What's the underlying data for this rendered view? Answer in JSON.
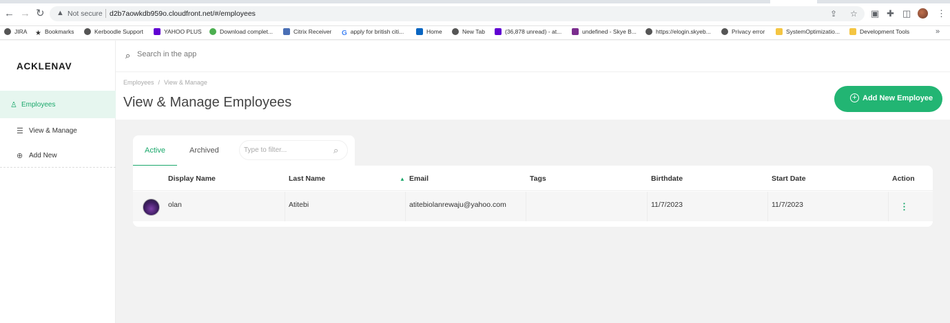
{
  "browser": {
    "security_label": "Not secure",
    "url": "d2b7aowkdb959o.cloudfront.net/#/employees",
    "bookmarks": [
      {
        "label": "JIRA"
      },
      {
        "label": "Bookmarks"
      },
      {
        "label": "Kerboodle Support"
      },
      {
        "label": "YAHOO PLUS"
      },
      {
        "label": "Download complet..."
      },
      {
        "label": "Citrix Receiver"
      },
      {
        "label": "apply for british citi..."
      },
      {
        "label": "Home"
      },
      {
        "label": "New Tab"
      },
      {
        "label": "(36,878 unread) - at..."
      },
      {
        "label": "undefined - Skye B..."
      },
      {
        "label": "https://elogin.skyeb..."
      },
      {
        "label": "Privacy error"
      },
      {
        "label": "SystemOptimizatio..."
      },
      {
        "label": "Development Tools"
      }
    ],
    "overflow": "»"
  },
  "app": {
    "logo": "ACKLENAV",
    "search_placeholder": "Search in the app",
    "sidebar": {
      "section": "Employees",
      "items": [
        {
          "label": "View & Manage"
        },
        {
          "label": "Add New"
        }
      ]
    },
    "breadcrumb": {
      "root": "Employees",
      "sep": "/",
      "current": "View & Manage"
    },
    "page_title": "View & Manage Employees",
    "add_button": "Add New Employee",
    "tabs": [
      {
        "label": "Active"
      },
      {
        "label": "Archived"
      }
    ],
    "filter_placeholder": "Type to filter...",
    "table": {
      "headers": {
        "display_name": "Display Name",
        "last_name": "Last Name",
        "email": "Email",
        "tags": "Tags",
        "birthdate": "Birthdate",
        "start_date": "Start Date",
        "action": "Action"
      },
      "rows": [
        {
          "display_name": "olan",
          "last_name": "Atitebi",
          "email": "atitebiolanrewaju@yahoo.com",
          "tags": "",
          "birthdate": "11/7/2023",
          "start_date": "11/7/2023"
        }
      ]
    }
  },
  "colors": {
    "accent": "#22b573",
    "accent_text": "#1aa86b",
    "sidebar_active_bg": "#e6f6ef"
  }
}
